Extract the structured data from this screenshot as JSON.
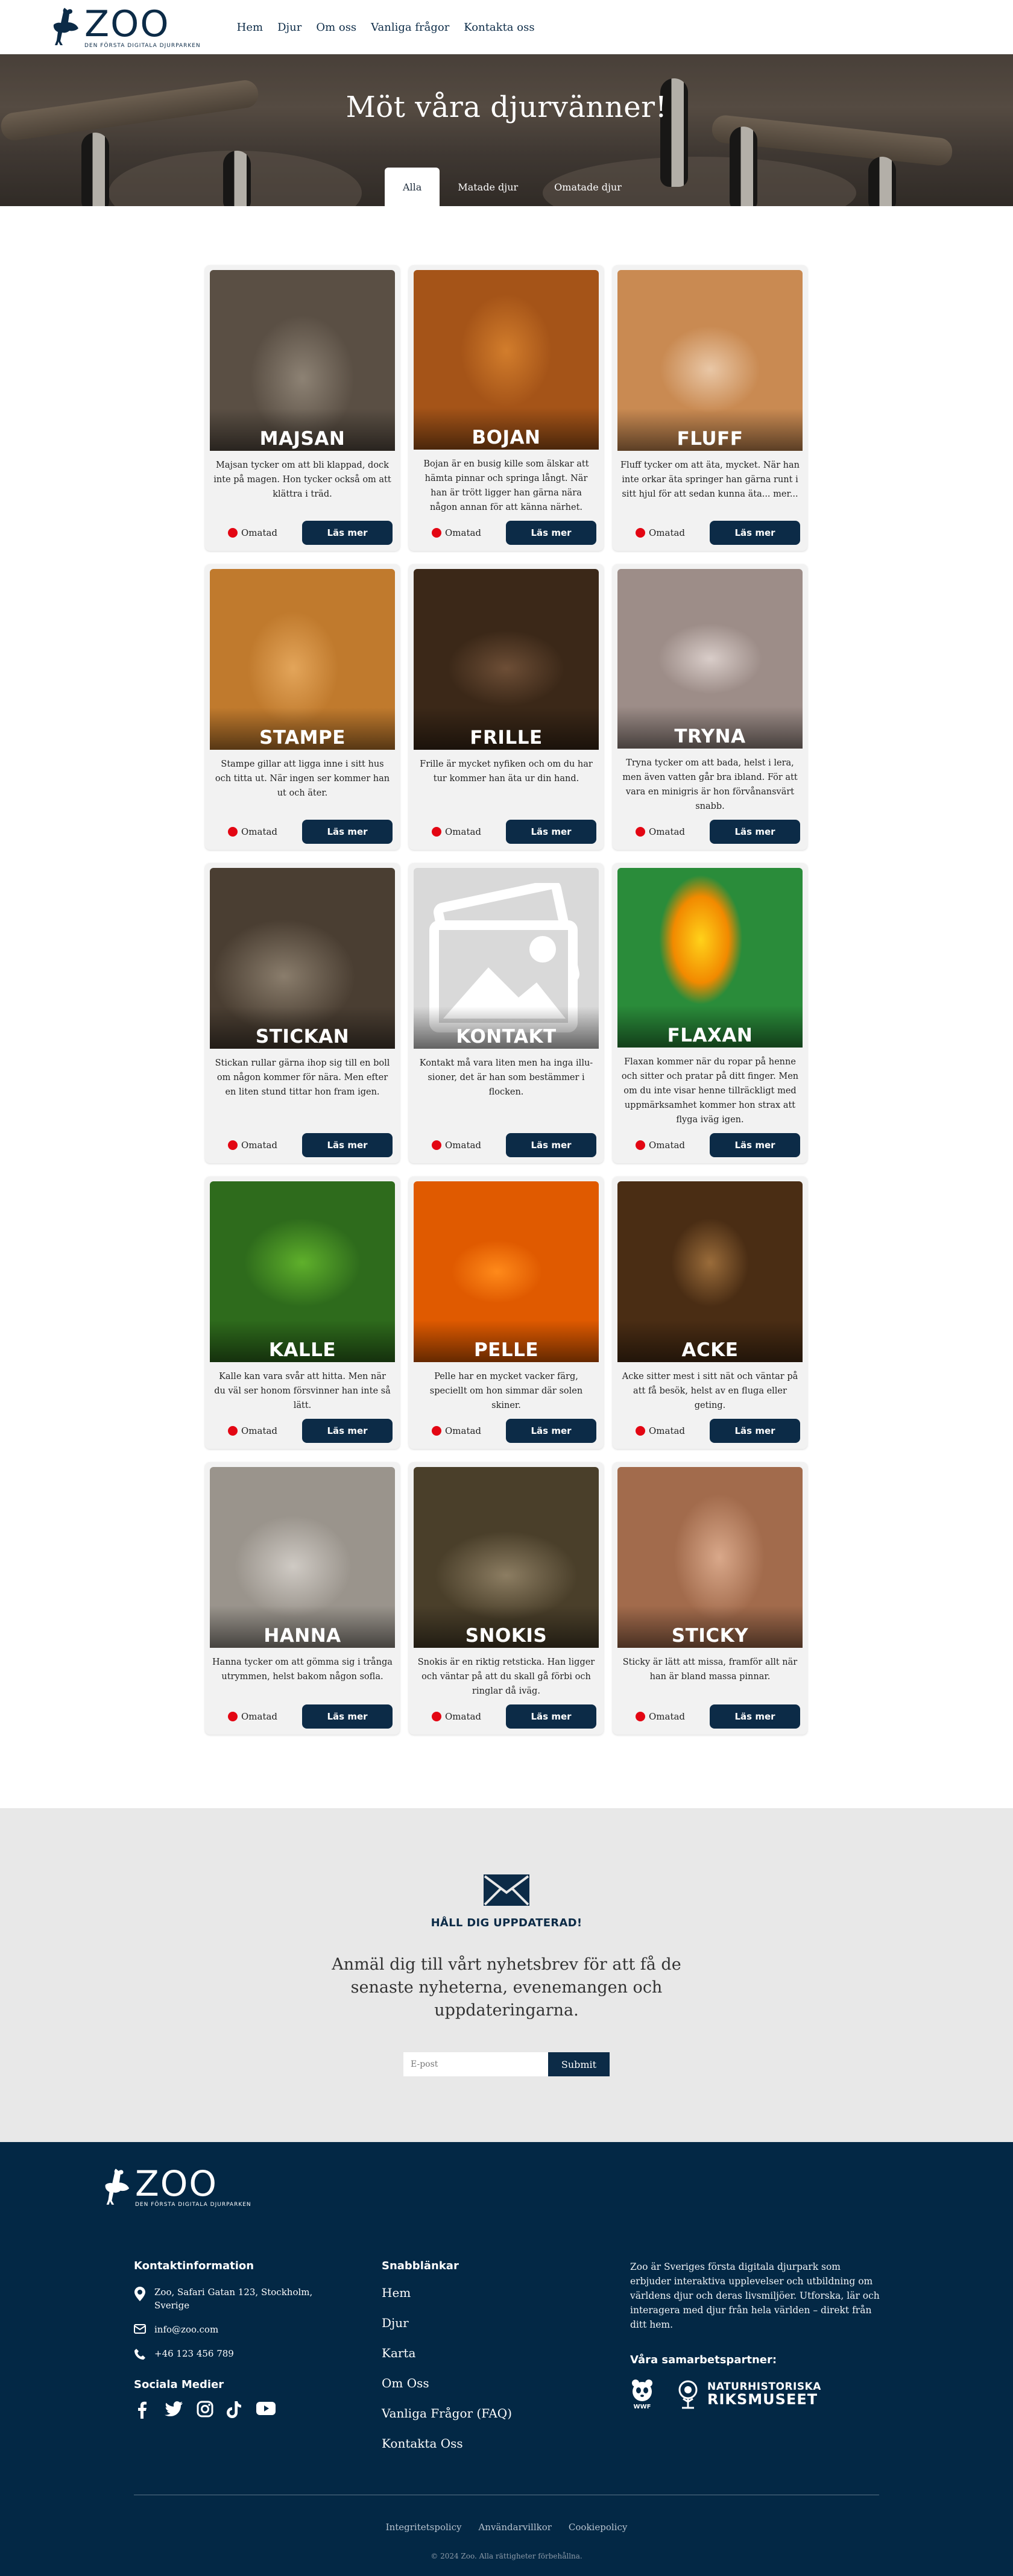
{
  "nav": {
    "logo_word": "ZOO",
    "logo_tagline": "DEN FÖRSTA DIGITALA DJURPARKEN",
    "links": [
      "Hem",
      "Djur",
      "Om oss",
      "Vanliga frågor",
      "Kontakta oss"
    ]
  },
  "hero": {
    "title": "Möt våra djurvänner!",
    "tabs": [
      "Alla",
      "Matade djur",
      "Omatade djur"
    ],
    "active_tab": "Alla"
  },
  "cards": [
    {
      "name": "MAJSAN",
      "image": "cat-photo",
      "desc": "Majsan tycker om att bli klappad, dock inte på magen. Hon tycker också om att klättra i träd.",
      "status": "Omatad",
      "button": "Läs mer"
    },
    {
      "name": "BOJAN",
      "image": "dog-photo",
      "desc": "Bojan är en busig kille som älskar att hämta pinnar och springa långt. När han är trött ligger han gärna nära någon annan för att känna närhet.",
      "status": "Omatad",
      "button": "Läs mer"
    },
    {
      "name": "FLUFF",
      "image": "hamster-photo",
      "desc": "Fluff tycker om att äta, mycket. När han inte orkar äta springer han gärna runt i sitt hjul för att sedan kunna äta... mer...",
      "status": "Omatad",
      "button": "Läs mer"
    },
    {
      "name": "STAMPE",
      "image": "rabbit-photo",
      "desc": "Stampe gillar att ligga inne i sitt hus och titta ut. När ingen ser kommer han ut och äter.",
      "status": "Omatad",
      "button": "Läs mer"
    },
    {
      "name": "FRILLE",
      "image": "ferret-photo",
      "desc": "Frille är mycket nyfiken och om du har tur kommer han äta ur din hand.",
      "status": "Omatad",
      "button": "Läs mer"
    },
    {
      "name": "TRYNA",
      "image": "pig-photo",
      "desc": "Tryna tycker om att bada, helst i lera, men även vatten går bra ibland. För att vara en minigris är hon förvånansvärt snabb.",
      "status": "Omatad",
      "button": "Läs mer"
    },
    {
      "name": "STICKAN",
      "image": "hedgehog-photo",
      "desc": "Stickan rullar gärna ihop sig till en boll om någon kommer för nära. Men efter en liten stund tittar hon fram igen.",
      "status": "Omatad",
      "button": "Läs mer"
    },
    {
      "name": "KONTAKT",
      "image": "placeholder-image-icon",
      "desc": "Kontakt må vara liten men ha inga illu- sioner, det är han som bestämmer i flocken.",
      "status": "Omatad",
      "button": "Läs mer"
    },
    {
      "name": "FLAXAN",
      "image": "parrot-photo",
      "desc": "Flaxan kommer när du ropar på henne och sitter och pratar på ditt finger. Men om du inte visar henne tillräckligt med uppmärksamhet kommer hon strax att flyga iväg igen.",
      "status": "Omatad",
      "button": "Läs mer"
    },
    {
      "name": "KALLE",
      "image": "chameleon-photo",
      "desc": "Kalle kan vara svår att hitta. Men när du väl ser honom försvinner han inte så lätt.",
      "status": "Omatad",
      "button": "Läs mer"
    },
    {
      "name": "PELLE",
      "image": "goldfish-photo",
      "desc": "Pelle har en mycket vacker färg, speciellt om hon simmar där solen skiner.",
      "status": "Omatad",
      "button": "Läs mer"
    },
    {
      "name": "ACKE",
      "image": "spider-photo",
      "desc": "Acke sitter mest i sitt nät och väntar på att få besök, helst av en fluga eller geting.",
      "status": "Omatad",
      "button": "Läs mer"
    },
    {
      "name": "HANNA",
      "image": "chinchilla-photo",
      "desc": "Hanna tycker om att gömma sig i trånga utrymmen, helst bakom någon sofla.",
      "status": "Omatad",
      "button": "Läs mer"
    },
    {
      "name": "SNOKIS",
      "image": "snake-photo",
      "desc": "Snokis är en riktig retsticka. Han ligger och väntar på att du skall gå förbi och ringlar då iväg.",
      "status": "Omatad",
      "button": "Läs mer"
    },
    {
      "name": "STICKY",
      "image": "stick-insect-photo",
      "desc": "Sticky är lätt att missa, framför allt när han är bland massa pinnar.",
      "status": "Omatad",
      "button": "Läs mer"
    }
  ],
  "newsletter": {
    "title": "HÅLL DIG UPPDATERAD!",
    "text": "Anmäl dig till vårt nyhetsbrev för att få de senaste nyheterna, evenemangen och uppdateringarna.",
    "placeholder": "E-post",
    "submit": "Submit"
  },
  "footer": {
    "logo_word": "ZOO",
    "logo_tagline": "DEN FÖRSTA DIGITALA DJURPARKEN",
    "contact_heading": "Kontaktinformation",
    "address": "Zoo, Safari Gatan 123, Stockholm, Sverige",
    "email": "info@zoo.com",
    "phone": "+46 123 456 789",
    "social_heading": "Sociala Medier",
    "quick_heading": "Snabblänkar",
    "quick_links": [
      "Hem",
      "Djur",
      "Karta",
      "Om Oss",
      "Vanliga Frågor (FAQ)",
      "Kontakta Oss"
    ],
    "about": "Zoo är Sveriges första digitala djurpark som erbjuder interaktiva upplevelser och utbildning om världens djur och deras livsmiljöer. Utforska, lär och interagera med djur från hela världen – direkt från ditt hem.",
    "partners_heading": "Våra samarbetspartner:",
    "partner_wwf": "WWF",
    "partner_nrm_line1": "NATURHISTORISKA",
    "partner_nrm_line2": "RIKSMUSEET",
    "legal_links": [
      "Integritetspolicy",
      "Användarvillkor",
      "Cookiepolicy"
    ],
    "copyright": "© 2024 Zoo. Alla rättigheter förbehållna."
  },
  "colors": {
    "brand_navy": "#0c2b47",
    "footer_bg": "#032845",
    "status_dot": "#e30613",
    "newsletter_bg": "#e8e8e8"
  }
}
